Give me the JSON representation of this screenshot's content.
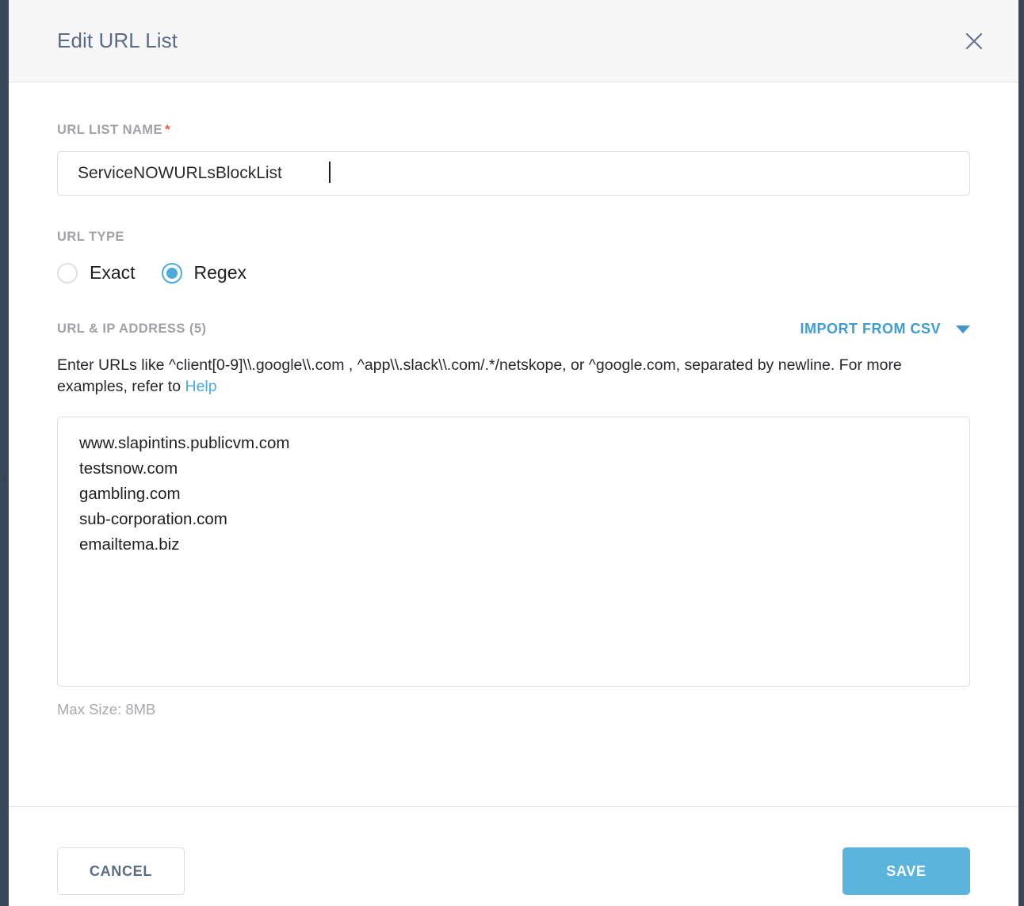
{
  "dialog": {
    "title": "Edit URL List",
    "close_icon": "close-icon"
  },
  "name_field": {
    "label": "URL LIST NAME",
    "required_marker": "*",
    "value": "ServiceNOWURLsBlockList",
    "placeholder": ""
  },
  "url_type": {
    "label": "URL TYPE",
    "options": [
      {
        "label": "Exact",
        "selected": false
      },
      {
        "label": "Regex",
        "selected": true
      }
    ]
  },
  "url_list": {
    "label": "URL & IP ADDRESS (5)",
    "count": 5,
    "import_button": {
      "label": "IMPORT FROM CSV",
      "caret_icon": "chevron-down-icon"
    },
    "helper_text_before_link": "Enter URLs like ^client[0-9]\\\\.google\\\\.com , ^app\\\\.slack\\\\.com/.*/netskope, or ^google.com, separated by newline. For more examples, refer to ",
    "help_link_label": "Help",
    "textarea_value": "www.slapintins.publicvm.com\ntestsnow.com\ngambling.com\nsub-corporation.com\nemailtema.biz",
    "textarea_placeholder": "",
    "max_size_note": "Max Size: 8MB"
  },
  "footer": {
    "cancel_label": "CANCEL",
    "save_label": "SAVE"
  },
  "colors": {
    "accent_blue": "#4dabda",
    "save_blue": "#5bb4dc",
    "link_blue": "#3f9dd0",
    "title_slate": "#5a6b84",
    "required_red": "#e8604c",
    "app_background": "#3a4759"
  }
}
